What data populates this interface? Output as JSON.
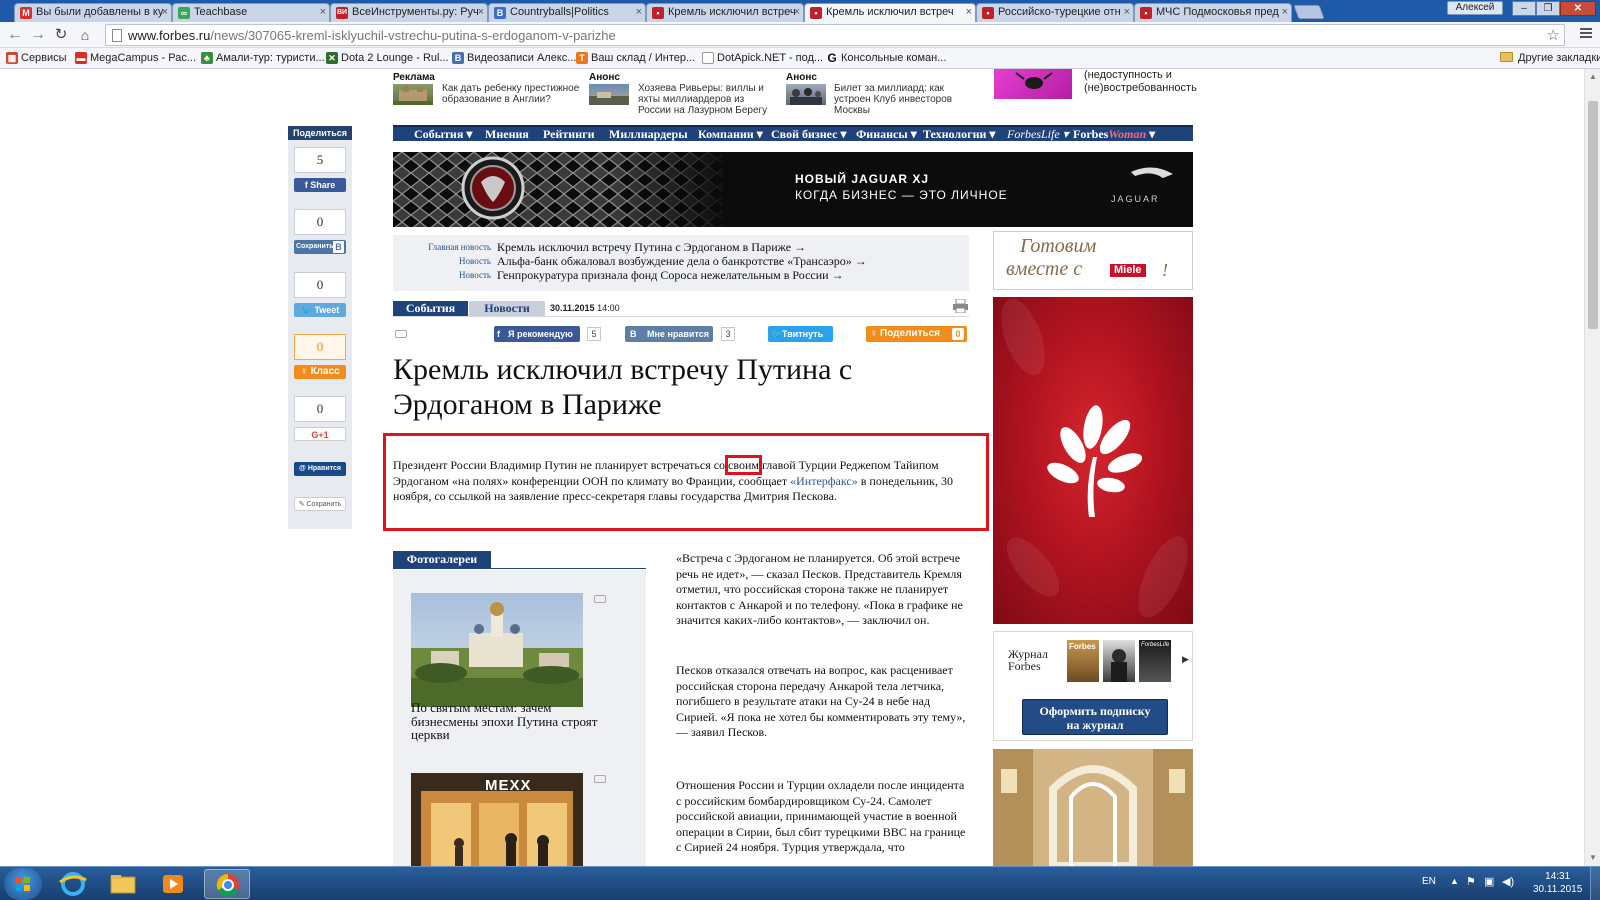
{
  "browser": {
    "tabs": [
      {
        "label": "Вы были добавлены в ку",
        "fav_color": "#d93025",
        "fav": "M"
      },
      {
        "label": "Teachbase",
        "fav_color": "#3aa757",
        "fav": "∞"
      },
      {
        "label": "ВсеИнструменты.ру: Руч",
        "fav_color": "#c0202a",
        "fav": "ВИ"
      },
      {
        "label": "Countryballs|Politics",
        "fav_color": "#3a6fc7",
        "fav": "B"
      },
      {
        "label": "Кремль исключил встреч",
        "fav_color": "#c0202a",
        "fav": "▪"
      },
      {
        "label": "Кремль исключил встреч",
        "fav_color": "#c0202a",
        "fav": "▪"
      },
      {
        "label": "Российско-турецкие отн",
        "fav_color": "#c0202a",
        "fav": "▪"
      },
      {
        "label": "МЧС Подмосковья пред",
        "fav_color": "#c0202a",
        "fav": "▪"
      }
    ],
    "active_tab": 5,
    "user": "Алексей",
    "url_host": "www.forbes.ru",
    "url_path": "/news/307065-kreml-isklyuchil-vstrechu-putina-s-erdoganom-v-parizhe",
    "bookmarks": [
      {
        "label": "Сервисы",
        "color": "#555"
      },
      {
        "label": "MegaCampus - Рас...",
        "color": "#d93025"
      },
      {
        "label": "Амали-тур: туристи...",
        "color": "#3a8f3a"
      },
      {
        "label": "Dota 2 Lounge - Rul...",
        "color": "#2f6e2f"
      },
      {
        "label": "Видеозаписи Алекс...",
        "color": "#4a6ea8"
      },
      {
        "label": "Ваш склад / Интер...",
        "color": "#e8761c"
      },
      {
        "label": "DotApick.NET - под...",
        "color": "#888"
      },
      {
        "label": "Консольные коман...",
        "color": "#111"
      }
    ],
    "other_bookmarks": "Другие закладки"
  },
  "promo": {
    "items": [
      {
        "label": "Реклама",
        "text": "Как дать ребенку престижное образование в Англии?"
      },
      {
        "label": "Анонс",
        "text": "Хозяева Ривьеры: виллы и яхты миллиардеров из России на Лазурном Берегу"
      },
      {
        "label": "Анонс",
        "text": "Билет за миллиард: как устроен Клуб инвесторов Москвы"
      }
    ],
    "right_text": "(недоступность и (не)востребованность"
  },
  "share": {
    "title": "Поделиться",
    "fb_count": "5",
    "fb_label": "Share",
    "vk_count": "0",
    "vk_label": "Сохранить",
    "vk_badge": "В",
    "tw_count": "0",
    "tw_label": "Tweet",
    "ok_count": "0",
    "ok_label": "Класс",
    "gp_count": "0",
    "gp_label": "G+1",
    "mail_label": "Нравится",
    "save_label": "Сохранить"
  },
  "nav": [
    "События",
    "Мнения",
    "Рейтинги",
    "Миллиардеры",
    "Компании",
    "Свой бизнес",
    "Финансы",
    "Технологии",
    "ForbesLife",
    "Forbes",
    "Woman"
  ],
  "banner": {
    "line1": "НОВЫЙ JAGUAR XJ",
    "line2": "КОГДА БИЗНЕС — ЭТО ЛИЧНОЕ",
    "logo": "JAGUAR"
  },
  "newsbox": [
    {
      "label": "Главная новость",
      "text": "Кремль исключил встречу Путина с Эрдоганом в Париже →"
    },
    {
      "label": "Новость",
      "text": "Альфа-банк обжаловал возбуждение дела о банкротстве «Трансаэро» →"
    },
    {
      "label": "Новость",
      "text": "Генпрокуратура признала фонд Сороса нежелательным в России →"
    }
  ],
  "article": {
    "tab_events": "События",
    "tab_news": "Новости",
    "date": "30.11.2015",
    "time": "14:00",
    "fb_rec": "Я рекомендую",
    "fb_rec_count": "5",
    "vk_like": "Мне нравится",
    "vk_like_count": "3",
    "tweet": "Твитнуть",
    "share": "Поделиться",
    "share_count": "0",
    "headline": "Кремль исключил встречу Путина с Эрдоганом в Париже",
    "lead_1": "Президент России Владимир Путин не планирует встречаться со ",
    "lead_hl": "своим",
    "lead_2": " главой Турции Реджепом Тайипом Эрдоганом «на полях» конференции ООН по климату во Франции, сообщает ",
    "lead_link": "«Интерфакс»",
    "lead_3": " в понедельник, 30 ноября, со ссылкой на заявление пресс-секретаря главы государства Дмитрия Пескова.",
    "p1": "«Встреча с Эрдоганом не планируется. Об этой встрече речь не идет», — сказал Песков. Представитель Кремля отметил, что российская сторона также не планирует контактов с Анкарой и по телефону. «Пока в графике не значится каких-либо контактов», — заключил он.",
    "p2": "Песков отказался отвечать на вопрос, как расценивает российская сторона передачу Анкарой тела летчика, погибшего в результате атаки на Су-24 в небе над Сирией. «Я пока не хотел бы комментировать эту тему», — заявил Песков.",
    "p3": "Отношения России и Турции охладели после инцидента с российским бомбардировщиком Су-24. Самолет российской авиации, принимающей участие в военной операции в Сирии, был сбит турецкими ВВС на границе с Сирией 24 ноября. Турция утверждала, что"
  },
  "gallery": {
    "title": "Фотогалереи",
    "caption": "По святым местам: зачем бизнесмены эпохи Путина строят церкви",
    "photo2_sign": "МЕХХ"
  },
  "sidebar": {
    "miele_text_1": "Готовим",
    "miele_text_2": "вместе с",
    "miele_brand": "Miele",
    "journal_line1": "Журнал",
    "journal_line2": "Forbes",
    "cover1": "Forbes",
    "cover3": "ForbesLife",
    "subscribe_1": "Оформить подписку",
    "subscribe_2": "на журнал"
  },
  "taskbar": {
    "lang": "EN",
    "time": "14:31",
    "date": "30.11.2015"
  }
}
